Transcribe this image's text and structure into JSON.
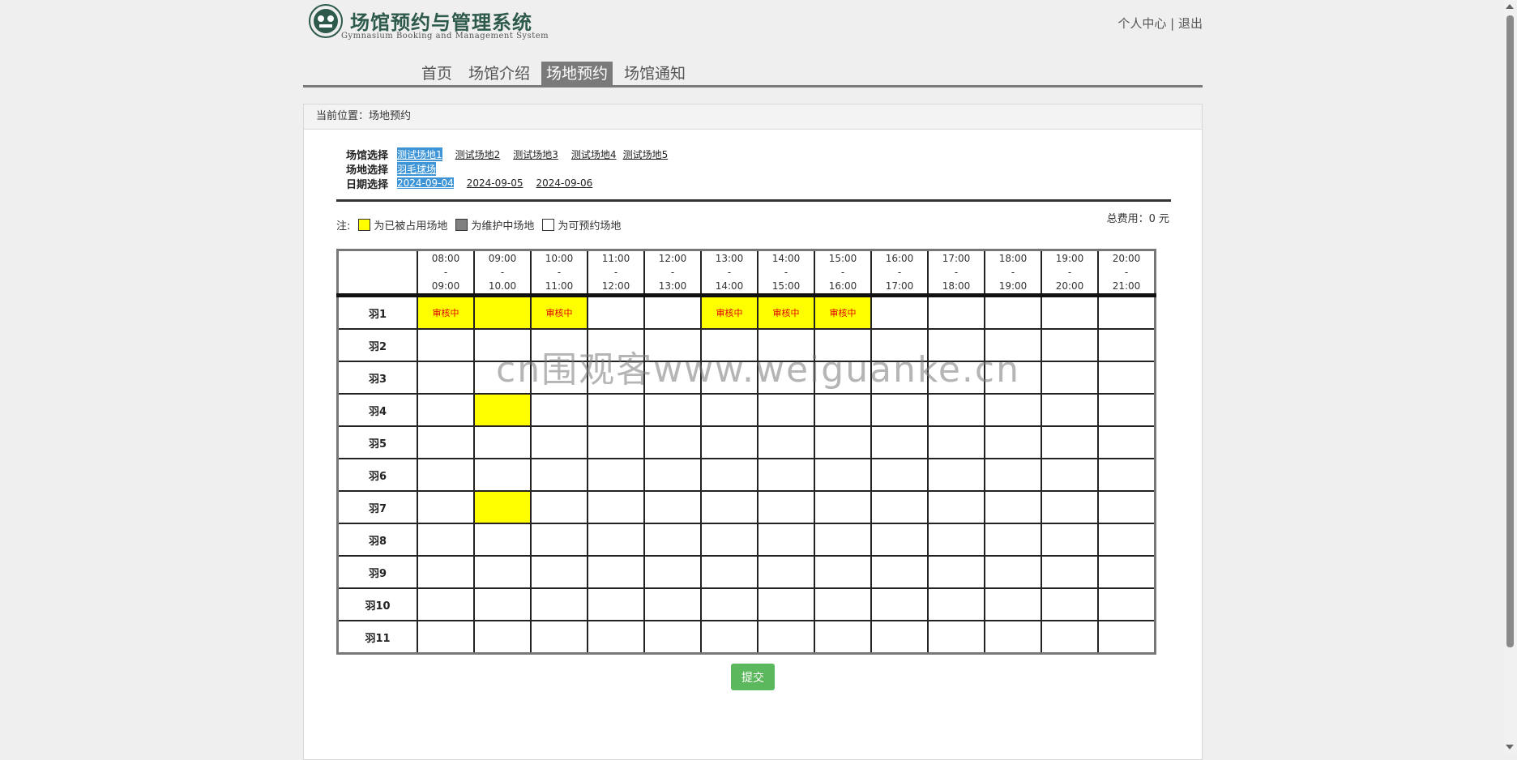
{
  "header": {
    "title": "场馆预约与管理系统",
    "subtitle": "Gymnasium Booking and Management System",
    "user_center": "个人中心",
    "separator": "|",
    "logout": "退出"
  },
  "nav": {
    "items": [
      {
        "label": "首页",
        "active": false
      },
      {
        "label": "场馆介绍",
        "active": false
      },
      {
        "label": "场地预约",
        "active": true
      },
      {
        "label": "场馆通知",
        "active": false
      }
    ]
  },
  "breadcrumb": "当前位置：场地预约",
  "filters": {
    "venue_label": "场馆选择",
    "venues": [
      "测试场地1",
      "测试场地2",
      "测试场地3",
      "测试场地4",
      "测试场地5"
    ],
    "venue_selected": "测试场地1",
    "court_label": "场地选择",
    "courts": [
      "羽毛球场"
    ],
    "court_selected": "羽毛球场",
    "date_label": "日期选择",
    "dates": [
      "2024-09-04",
      "2024-09-05",
      "2024-09-06"
    ],
    "date_selected": "2024-09-04"
  },
  "legend": {
    "prefix": "注:",
    "occupied": "为已被占用场地",
    "maintenance": "为维护中场地",
    "available": "为可预约场地"
  },
  "total": "总费用：0 元",
  "colors": {
    "occupied": "#ffff00",
    "maintenance": "#808080",
    "available": "#ffffff",
    "pending_text": "#e00000",
    "nav_active": "#7a7a7a",
    "submit": "#5cb85c",
    "selected_link": "#3d94d6"
  },
  "schedule": {
    "time_slots": [
      {
        "start": "08:00",
        "dash": "-",
        "end": "09:00"
      },
      {
        "start": "09:00",
        "dash": "-",
        "end": "10.00"
      },
      {
        "start": "10:00",
        "dash": "-",
        "end": "11:00"
      },
      {
        "start": "11:00",
        "dash": "-",
        "end": "12:00"
      },
      {
        "start": "12:00",
        "dash": "-",
        "end": "13:00"
      },
      {
        "start": "13:00",
        "dash": "-",
        "end": "14:00"
      },
      {
        "start": "14:00",
        "dash": "-",
        "end": "15:00"
      },
      {
        "start": "15:00",
        "dash": "-",
        "end": "16:00"
      },
      {
        "start": "16:00",
        "dash": "-",
        "end": "17:00"
      },
      {
        "start": "17:00",
        "dash": "-",
        "end": "18:00"
      },
      {
        "start": "18:00",
        "dash": "-",
        "end": "19:00"
      },
      {
        "start": "19:00",
        "dash": "-",
        "end": "20:00"
      },
      {
        "start": "20:00",
        "dash": "-",
        "end": "21:00"
      }
    ],
    "courts": [
      {
        "name": "羽1",
        "cells": [
          "审核中",
          "occupied",
          "审核中",
          "",
          "",
          "审核中",
          "审核中",
          "审核中",
          "",
          "",
          "",
          "",
          ""
        ]
      },
      {
        "name": "羽2",
        "cells": [
          "",
          "",
          "",
          "",
          "",
          "",
          "",
          "",
          "",
          "",
          "",
          "",
          ""
        ]
      },
      {
        "name": "羽3",
        "cells": [
          "",
          "",
          "",
          "",
          "",
          "",
          "",
          "",
          "",
          "",
          "",
          "",
          ""
        ]
      },
      {
        "name": "羽4",
        "cells": [
          "",
          "occupied",
          "",
          "",
          "",
          "",
          "",
          "",
          "",
          "",
          "",
          "",
          ""
        ]
      },
      {
        "name": "羽5",
        "cells": [
          "",
          "",
          "",
          "",
          "",
          "",
          "",
          "",
          "",
          "",
          "",
          "",
          ""
        ]
      },
      {
        "name": "羽6",
        "cells": [
          "",
          "",
          "",
          "",
          "",
          "",
          "",
          "",
          "",
          "",
          "",
          "",
          ""
        ]
      },
      {
        "name": "羽7",
        "cells": [
          "",
          "occupied",
          "",
          "",
          "",
          "",
          "",
          "",
          "",
          "",
          "",
          "",
          ""
        ]
      },
      {
        "name": "羽8",
        "cells": [
          "",
          "",
          "",
          "",
          "",
          "",
          "",
          "",
          "",
          "",
          "",
          "",
          ""
        ]
      },
      {
        "name": "羽9",
        "cells": [
          "",
          "",
          "",
          "",
          "",
          "",
          "",
          "",
          "",
          "",
          "",
          "",
          ""
        ]
      },
      {
        "name": "羽10",
        "cells": [
          "",
          "",
          "",
          "",
          "",
          "",
          "",
          "",
          "",
          "",
          "",
          "",
          ""
        ]
      },
      {
        "name": "羽11",
        "cells": [
          "",
          "",
          "",
          "",
          "",
          "",
          "",
          "",
          "",
          "",
          "",
          "",
          ""
        ]
      }
    ]
  },
  "submit_label": "提交",
  "watermark": "cn围观客www.weiguanke.cn"
}
